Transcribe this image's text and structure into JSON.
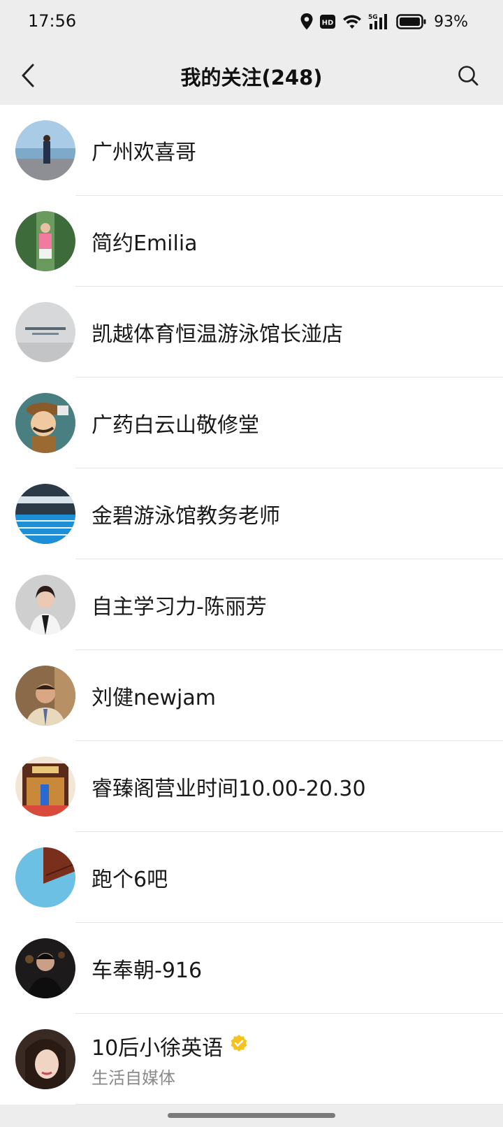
{
  "status_bar": {
    "time": "17:56",
    "network": "5G",
    "hd": "HD",
    "battery": "93%"
  },
  "nav": {
    "title": "我的关注(248)",
    "back_icon": "chevron-left-icon",
    "search_icon": "search-icon"
  },
  "list": {
    "items": [
      {
        "name": "广州欢喜哥"
      },
      {
        "name": "简约Emilia"
      },
      {
        "name": "凯越体育恒温游泳馆长湴店"
      },
      {
        "name": "广药白云山敬修堂"
      },
      {
        "name": "金碧游泳馆教务老师"
      },
      {
        "name": "自主学习力-陈丽芳"
      },
      {
        "name": "刘健newjam"
      },
      {
        "name": "睿臻阁营业时间10.00-20.30"
      },
      {
        "name": "跑个6吧"
      },
      {
        "name": "车奉朝-916"
      },
      {
        "name": "10后小徐英语",
        "subtitle": "生活自媒体",
        "verified": true,
        "verified_color": "#f6c21c"
      }
    ]
  }
}
